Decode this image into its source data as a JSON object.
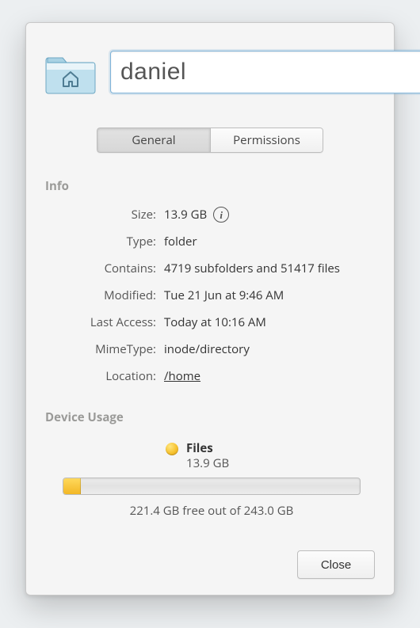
{
  "name_value": "daniel",
  "tabs": {
    "general": "General",
    "permissions": "Permissions"
  },
  "info_heading": "Info",
  "info": {
    "size": {
      "label": "Size:",
      "value": "13.9 GB"
    },
    "type": {
      "label": "Type:",
      "value": "folder"
    },
    "contains": {
      "label": "Contains:",
      "value": "4719 subfolders and 51417 files"
    },
    "modified": {
      "label": "Modified:",
      "value": "Tue 21 Jun at 9:46 AM"
    },
    "last_access": {
      "label": "Last Access:",
      "value": "Today at 10:16 AM"
    },
    "mimetype": {
      "label": "MimeType:",
      "value": "inode/directory"
    },
    "location": {
      "label": "Location:",
      "value": "/home"
    }
  },
  "usage_heading": "Device Usage",
  "usage": {
    "legend_title": "Files",
    "legend_value": "13.9 GB",
    "fill_percent": "5.7%",
    "caption": "221.4 GB free out of 243.0 GB"
  },
  "close_label": "Close"
}
